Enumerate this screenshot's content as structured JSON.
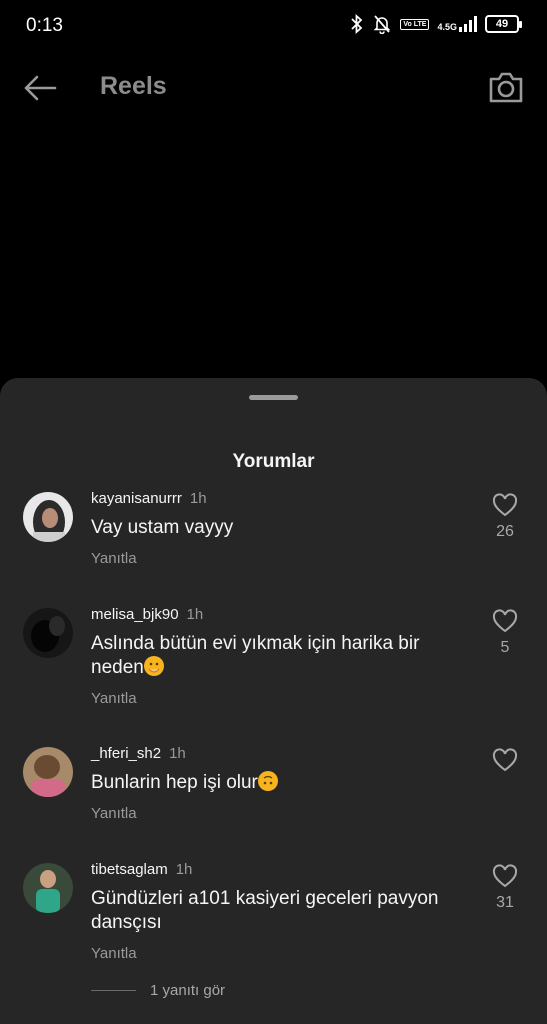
{
  "status_bar": {
    "time": "0:13",
    "network": "4.5G",
    "volte": "Vo LTE",
    "battery": "49"
  },
  "header": {
    "title": "Reels"
  },
  "comments_sheet": {
    "title": "Yorumlar",
    "comments": [
      {
        "username": "kayanisanurrr",
        "time": "1h",
        "text": "Vay ustam vayyy",
        "reply_label": "Yanıtla",
        "likes": "26"
      },
      {
        "username": "melisa_bjk90",
        "time": "1h",
        "text": "Aslında bütün evi yıkmak için harika bir neden",
        "emoji": "face-with-hand-over-mouth",
        "reply_label": "Yanıtla",
        "likes": "5"
      },
      {
        "username": "_hferi_sh2",
        "time": "1h",
        "text": "Bunlarin hep işi olur",
        "emoji": "upside-down-face",
        "reply_label": "Yanıtla",
        "likes": ""
      },
      {
        "username": "tibetsaglam",
        "time": "1h",
        "text": "Gündüzleri a101 kasiyeri geceleri pavyon dansçısı",
        "reply_label": "Yanıtla",
        "likes": "31"
      }
    ],
    "view_replies": "1 yanıtı gör"
  },
  "colors": {
    "background": "#000000",
    "sheet": "#262626",
    "secondary_text": "#9a9a9a"
  }
}
